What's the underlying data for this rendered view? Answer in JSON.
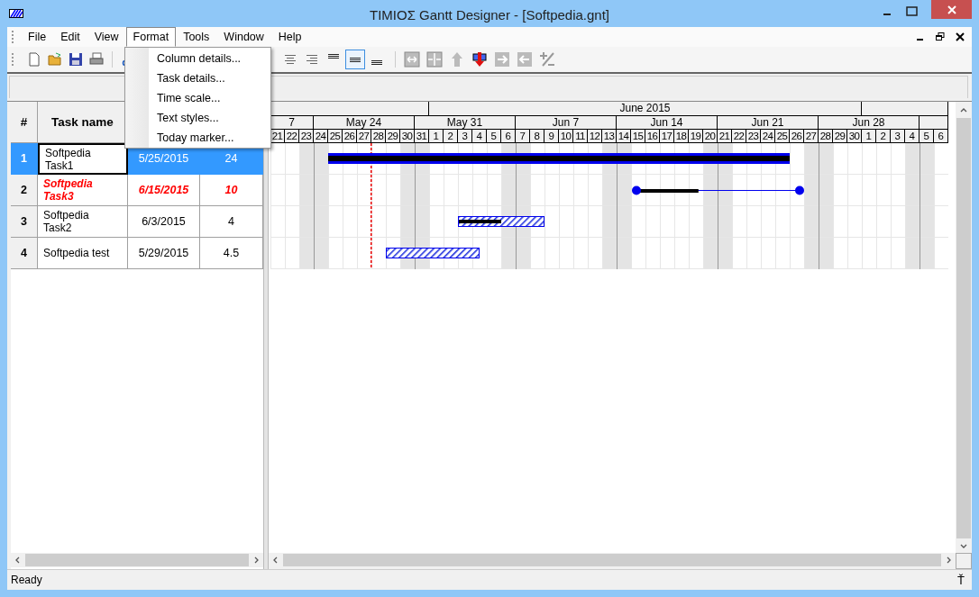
{
  "window": {
    "title": "ΤΙΜΙΟΣ Gantt Designer - [Softpedia.gnt]"
  },
  "menu": [
    {
      "label": "File",
      "selected": false
    },
    {
      "label": "Edit",
      "selected": false
    },
    {
      "label": "View",
      "selected": false
    },
    {
      "label": "Format",
      "selected": true
    },
    {
      "label": "Tools",
      "selected": false
    },
    {
      "label": "Window",
      "selected": false
    },
    {
      "label": "Help",
      "selected": false
    }
  ],
  "dropdown": [
    "Column details...",
    "Task details...",
    "Time scale...",
    "Text styles...",
    "Today marker..."
  ],
  "toolbar": {
    "align_buttons": [
      {
        "selected": false
      },
      {
        "selected": false
      },
      {
        "selected": false
      },
      {
        "selected": true
      },
      {
        "selected": false
      }
    ]
  },
  "grid": {
    "columns": [
      "#",
      "Task name"
    ],
    "rows": [
      {
        "num": "1",
        "name": "Softpedia Task1",
        "start": "5/25/2015",
        "duration": "24",
        "selected": true,
        "emphasis": false,
        "kind": "solid",
        "level": 1
      },
      {
        "num": "2",
        "name": "Softpedia Task3",
        "start": "6/15/2015",
        "duration": "10",
        "selected": false,
        "emphasis": true,
        "kind": "line",
        "level": 0.38
      },
      {
        "num": "3",
        "name": "Softpedia Task2",
        "start": "6/3/2015",
        "duration": "4",
        "selected": false,
        "emphasis": false,
        "kind": "hatched",
        "level": 0.5
      },
      {
        "num": "4",
        "name": "Softpedia test",
        "start": "5/29/2015",
        "duration": "4.5",
        "selected": false,
        "emphasis": false,
        "kind": "hatched"
      }
    ]
  },
  "timeline": {
    "months": [
      {
        "days": [
          {
            "label": "21",
            "weekend": false
          },
          {
            "label": "22",
            "weekend": false
          },
          {
            "label": "23",
            "weekend": true
          },
          {
            "label": "24",
            "weekend": true
          },
          {
            "label": "25",
            "weekend": false
          },
          {
            "label": "26",
            "weekend": false
          },
          {
            "label": "27",
            "weekend": false
          },
          {
            "label": "28",
            "weekend": false
          },
          {
            "label": "29",
            "weekend": false
          },
          {
            "label": "30",
            "weekend": true
          },
          {
            "label": "31",
            "weekend": true
          }
        ]
      },
      {
        "label": "June 2015",
        "days": [
          {
            "label": "1",
            "weekend": false
          },
          {
            "label": "2",
            "weekend": false
          },
          {
            "label": "3",
            "weekend": false
          },
          {
            "label": "4",
            "weekend": false
          },
          {
            "label": "5",
            "weekend": false
          },
          {
            "label": "6",
            "weekend": true
          },
          {
            "label": "7",
            "weekend": true
          },
          {
            "label": "8",
            "weekend": false
          },
          {
            "label": "9",
            "weekend": false
          },
          {
            "label": "10",
            "weekend": false
          },
          {
            "label": "11",
            "weekend": false
          },
          {
            "label": "12",
            "weekend": false
          },
          {
            "label": "13",
            "weekend": true
          },
          {
            "label": "14",
            "weekend": true
          },
          {
            "label": "15",
            "weekend": false
          },
          {
            "label": "16",
            "weekend": false
          },
          {
            "label": "17",
            "weekend": false
          },
          {
            "label": "18",
            "weekend": false
          },
          {
            "label": "19",
            "weekend": false
          },
          {
            "label": "20",
            "weekend": true
          },
          {
            "label": "21",
            "weekend": true
          },
          {
            "label": "22",
            "weekend": false
          },
          {
            "label": "23",
            "weekend": false
          },
          {
            "label": "24",
            "weekend": false
          },
          {
            "label": "25",
            "weekend": false
          },
          {
            "label": "26",
            "weekend": false
          },
          {
            "label": "27",
            "weekend": true
          },
          {
            "label": "28",
            "weekend": true
          },
          {
            "label": "29",
            "weekend": false
          },
          {
            "label": "30",
            "weekend": false
          }
        ]
      },
      {
        "days": [
          {
            "label": "1",
            "weekend": false
          },
          {
            "label": "2",
            "weekend": false
          },
          {
            "label": "3",
            "weekend": false
          },
          {
            "label": "4",
            "weekend": true
          },
          {
            "label": "5",
            "weekend": true
          },
          {
            "label": "6",
            "weekend": false
          }
        ]
      }
    ],
    "weeks": [
      "7",
      "May 24",
      "May 31",
      "Jun 7",
      "Jun 14",
      "Jun 21",
      "Jun 28"
    ],
    "today_marker": true
  },
  "status_bar": {
    "text": "Ready",
    "indicator": "Ť"
  }
}
